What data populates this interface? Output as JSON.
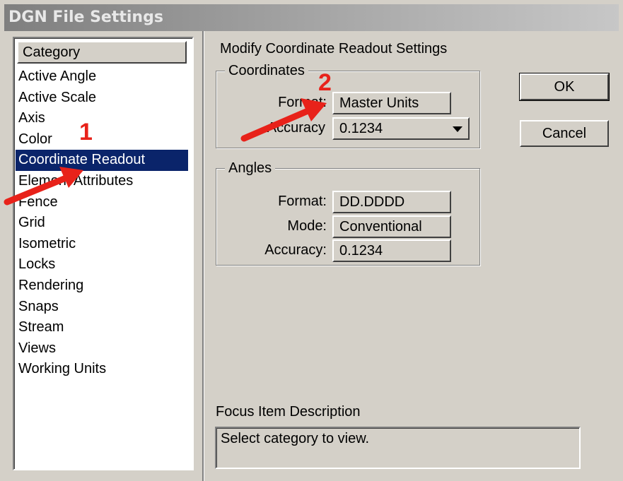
{
  "window": {
    "title": "DGN File Settings"
  },
  "category": {
    "header": "Category",
    "items": [
      "Active Angle",
      "Active Scale",
      "Axis",
      "Color",
      "Coordinate Readout",
      "Element Attributes",
      "Fence",
      "Grid",
      "Isometric",
      "Locks",
      "Rendering",
      "Snaps",
      "Stream",
      "Views",
      "Working Units"
    ],
    "selected": "Coordinate Readout"
  },
  "settings": {
    "title": "Modify Coordinate Readout Settings",
    "coordinates": {
      "legend": "Coordinates",
      "format_label": "Format:",
      "format_value": "Master Units",
      "accuracy_label": "Accuracy",
      "accuracy_value": "0.1234"
    },
    "angles": {
      "legend": "Angles",
      "format_label": "Format:",
      "format_value": "DD.DDDD",
      "mode_label": "Mode:",
      "mode_value": "Conventional",
      "accuracy_label": "Accuracy:",
      "accuracy_value": "0.1234"
    }
  },
  "buttons": {
    "ok": "OK",
    "cancel": "Cancel"
  },
  "focus": {
    "label": "Focus Item Description",
    "text": "Select category to view."
  },
  "annotations": {
    "marker_1": "1",
    "marker_2": "2",
    "arrow_color": "#e8221a"
  }
}
